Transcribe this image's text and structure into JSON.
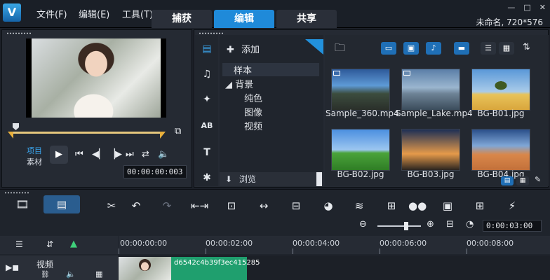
{
  "menu": {
    "file": "文件(F)",
    "edit": "编辑(E)",
    "tools": "工具(T)"
  },
  "tabs": [
    "捕获",
    "编辑",
    "共享"
  ],
  "active_tab": "编辑",
  "project_info": "未命名, 720*576",
  "window_buttons": {
    "minimize": "—",
    "maximize": "□",
    "close": "✕"
  },
  "player": {
    "mode_project": "项目",
    "mode_clip": "素材",
    "timecode": "00:00:00:003"
  },
  "library": {
    "add_label": "添加",
    "tree": {
      "sample": "样本",
      "background": "背景",
      "solid": "纯色",
      "image": "图像",
      "video": "视频"
    },
    "browse_label": "浏览",
    "media": [
      {
        "name": "Sample_360.mp4"
      },
      {
        "name": "Sample_Lake.mp4"
      },
      {
        "name": "BG-B01.jpg"
      },
      {
        "name": "BG-B02.jpg"
      },
      {
        "name": "BG-B03.jpg"
      },
      {
        "name": "BG-B04.jpg"
      }
    ]
  },
  "timeline": {
    "timecode": "0:00:03:00",
    "ruler": [
      "00:00:00:00",
      "00:00:02:00",
      "00:00:04:00",
      "00:00:06:00",
      "00:00:08:00"
    ],
    "track_name": "视频",
    "clip_name": "d6542c4b39f3ec415285"
  },
  "colors": {
    "accent": "#1f8ad9",
    "clip": "#1f9f6e",
    "trim_marker": "#e9b03c"
  }
}
